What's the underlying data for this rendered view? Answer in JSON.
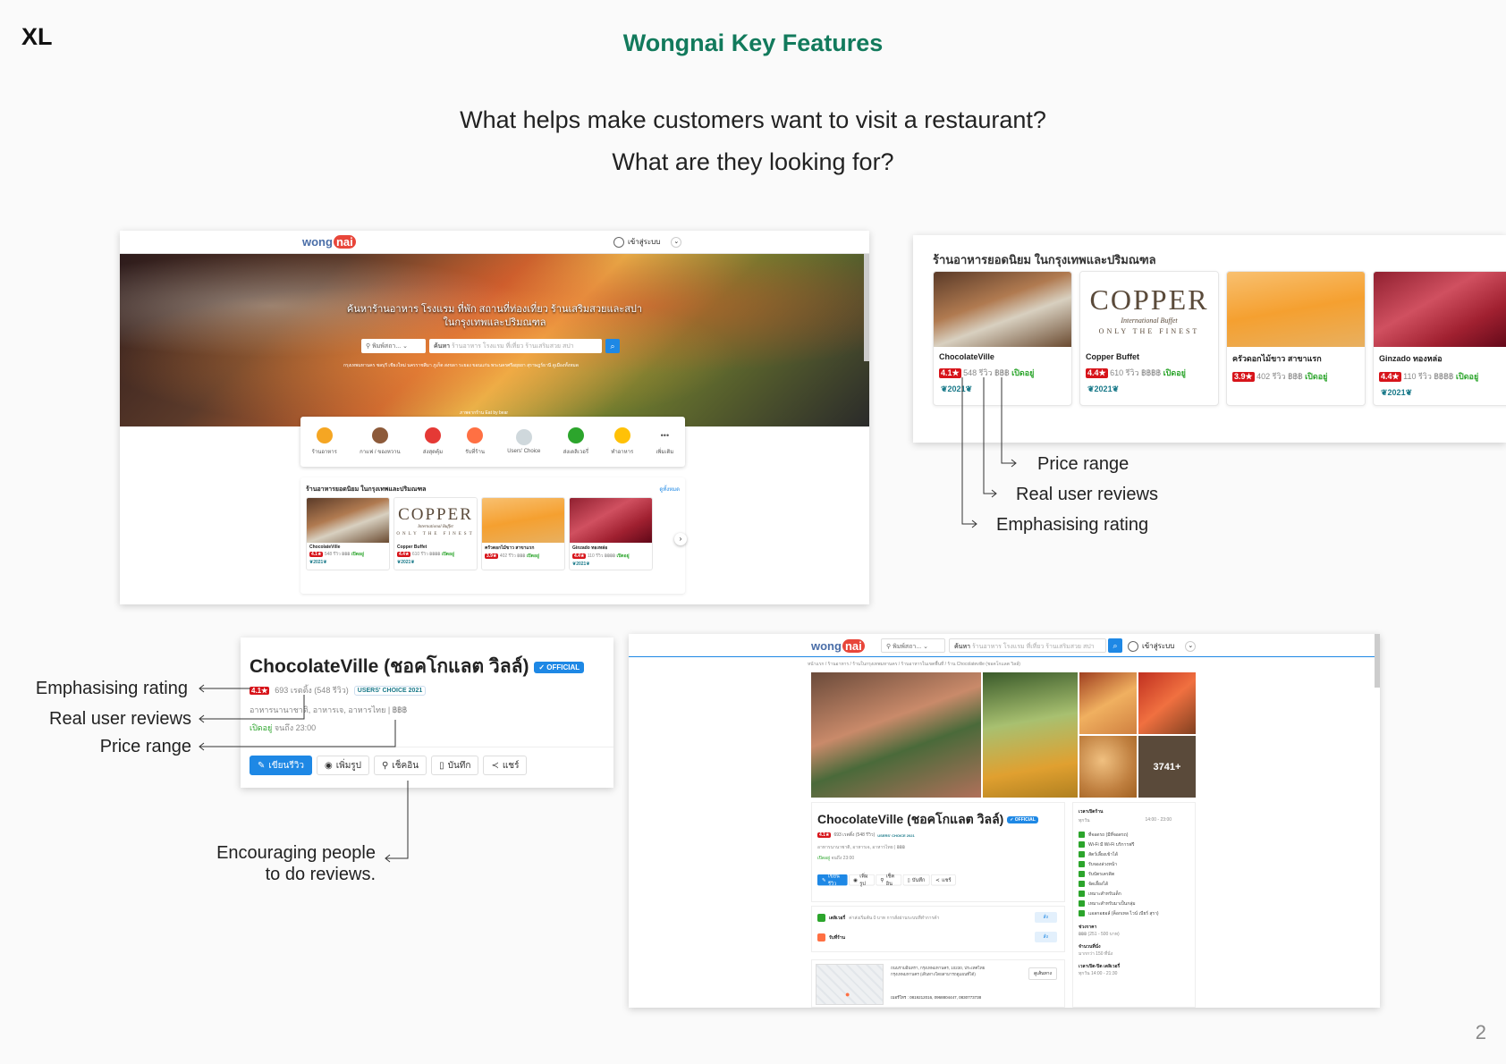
{
  "slide": {
    "size_tag": "XL",
    "title": "Wongnai Key Features",
    "question_1": "What helps make customers want to visit a restaurant?",
    "question_2": "What are they looking for?",
    "page_number": "2"
  },
  "annotations": {
    "price_range": "Price range",
    "real_user_reviews": "Real user reviews",
    "emphasising_rating": "Emphasising rating",
    "encouraging_1": "Encouraging people",
    "encouraging_2": "to do reviews."
  },
  "homepage": {
    "logo": "wong",
    "logo_badge": "nai",
    "login_label": "เข้าสู่ระบบ",
    "hero_title_1": "ค้นหาร้านอาหาร โรงแรม ที่พัก สถานที่ท่องเที่ยว ร้านเสริมสวยและสปา",
    "hero_title_2": "ในกรุงเทพและปริมณฑล",
    "location_label": "พิมพ์สถา...",
    "search_label": "ค้นหา",
    "search_placeholder": "ร้านอาหาร โรงแรม ที่เที่ยว ร้านเสริมสวย สปา",
    "popular_areas": "กรุงเทพมหานคร ชลบุรี เชียงใหม่ นครราชสีมา ภูเก็ต สงขลา ระยอง ขอนแก่น พระนครศรีอยุธยา สุราษฎร์ธานี ดูเมืองทั้งหมด",
    "photo_credit": "ภาพจากร้าน Eat by bear",
    "categories": [
      {
        "label": "ร้านอาหาร",
        "color": "#f5a623"
      },
      {
        "label": "กาแฟ / ของหวาน",
        "color": "#8d5a3a"
      },
      {
        "label": "ส่งสุดคุ้ม",
        "color": "#e53935"
      },
      {
        "label": "รับที่ร้าน",
        "color": "#ff7043"
      },
      {
        "label": "Users' Choice",
        "color": "#cfd8dc"
      },
      {
        "label": "ส่งเดลิเวอรี่",
        "color": "#2ca52c"
      },
      {
        "label": "ทำอาหาร",
        "color": "#ffc107"
      },
      {
        "label": "เพิ่มเติม",
        "color": "#ffffff"
      }
    ],
    "section_title": "ร้านอาหารยอดนิยม ในกรุงเทพและปริมณฑล",
    "see_all": "ดูทั้งหมด"
  },
  "restaurants": [
    {
      "name": "ChocolateVille",
      "rating": "4.1★",
      "reviews": "548 รีวิว",
      "price": "฿฿฿",
      "status": "เปิดอยู่",
      "award": "2021"
    },
    {
      "name": "Copper Buffet",
      "rating": "4.4★",
      "reviews": "610 รีวิว",
      "price": "฿฿฿฿",
      "status": "เปิดอยู่",
      "award": "2021"
    },
    {
      "name": "ครัวดอกไม้ขาว สาขาแรก",
      "rating": "3.9★",
      "reviews": "402 รีวิว",
      "price": "฿฿฿",
      "status": "เปิดอยู่",
      "award": ""
    },
    {
      "name": "Ginzado ทองหล่อ",
      "rating": "4.4★",
      "reviews": "110 รีวิว",
      "price": "฿฿฿฿",
      "status": "เปิดอยู่",
      "award": "2021"
    }
  ],
  "copper_logo": {
    "word": "COPPER",
    "script": "International Buffet",
    "tagline": "ONLY THE FINEST"
  },
  "detail": {
    "name": "ChocolateVille (ชอคโกแลต วิลล์)",
    "official": "✓ OFFICIAL",
    "rating": "4.1★",
    "reviews": "693 เรตติ้ง (548 รีวิว)",
    "users_choice": "USERS' CHOICE 2021",
    "categories": "อาหารนานาชาติ, อาหารเจ, อาหารไทย | ฿฿฿",
    "open_status": "เปิดอยู่",
    "open_until": "จนถึง 23:00",
    "btn_review": "เขียนรีวิว",
    "btn_photo": "เพิ่มรูป",
    "btn_checkin": "เช็คอิน",
    "btn_save": "บันทึก",
    "btn_share": "แชร์"
  },
  "detail_page": {
    "breadcrumb": "หน้าแรก / ร้านอาหาร / ร้านในกรุงเทพมหานคร / ร้านอาหารในเขตพื้นที่ / ร้าน Chocolateville (ชอคโกแลต วิลล์)",
    "photo_count": "3741+",
    "delivery_label": "เดลิเวอรี่",
    "delivery_text": "ค่าส่งเริ่มต้น 0 บาท การสั่งผ่านระบบที่ทำการค้า",
    "pickup_label": "รับที่ร้าน",
    "order_btn": "สั่ง",
    "address": "ถนนรามอินทรา, กรุงเทพมหานคร, 10230, ประเทศไทย",
    "address_2": "กรุงเทพมหานคร (เดินทางโดยสามารถดูแผนที่ได้)",
    "phone": "เบอร์โทร : 0819212016, 0968804447, 0830773738",
    "directions": "ดูเส้นทาง",
    "hours_title": "เวลาเปิดร้าน",
    "hours_day": "ทุกวัน",
    "hours_time": "14:00 - 23:00",
    "features": [
      "ที่จอดรถ (มีที่จอดรถ)",
      "Wi-Fi มี Wi-Fi บริการฟรี",
      "สัตว์เลี้ยงเข้าได้",
      "รับจองล่วงหน้า",
      "รับบัตรเครดิต",
      "จัดเลี้ยงได้",
      "เหมาะสำหรับเด็ก",
      "เหมาะสำหรับมาเป็นกลุ่ม",
      "แอลกอฮอล์ (ค็อกเทล ไวน์ เบียร์ สุรา)"
    ],
    "price_title": "ช่วงราคา",
    "price_value": "฿฿฿ (251 - 500 บาท)",
    "seats_title": "จำนวนที่นั่ง",
    "seats_value": "มากกว่า 150 ที่นั่ง",
    "delivery_hours_title": "เวลาเปิด-ปิด เดลิเวอรี่",
    "delivery_hours_value": "ทุกวัน 14:00 - 21:30"
  }
}
